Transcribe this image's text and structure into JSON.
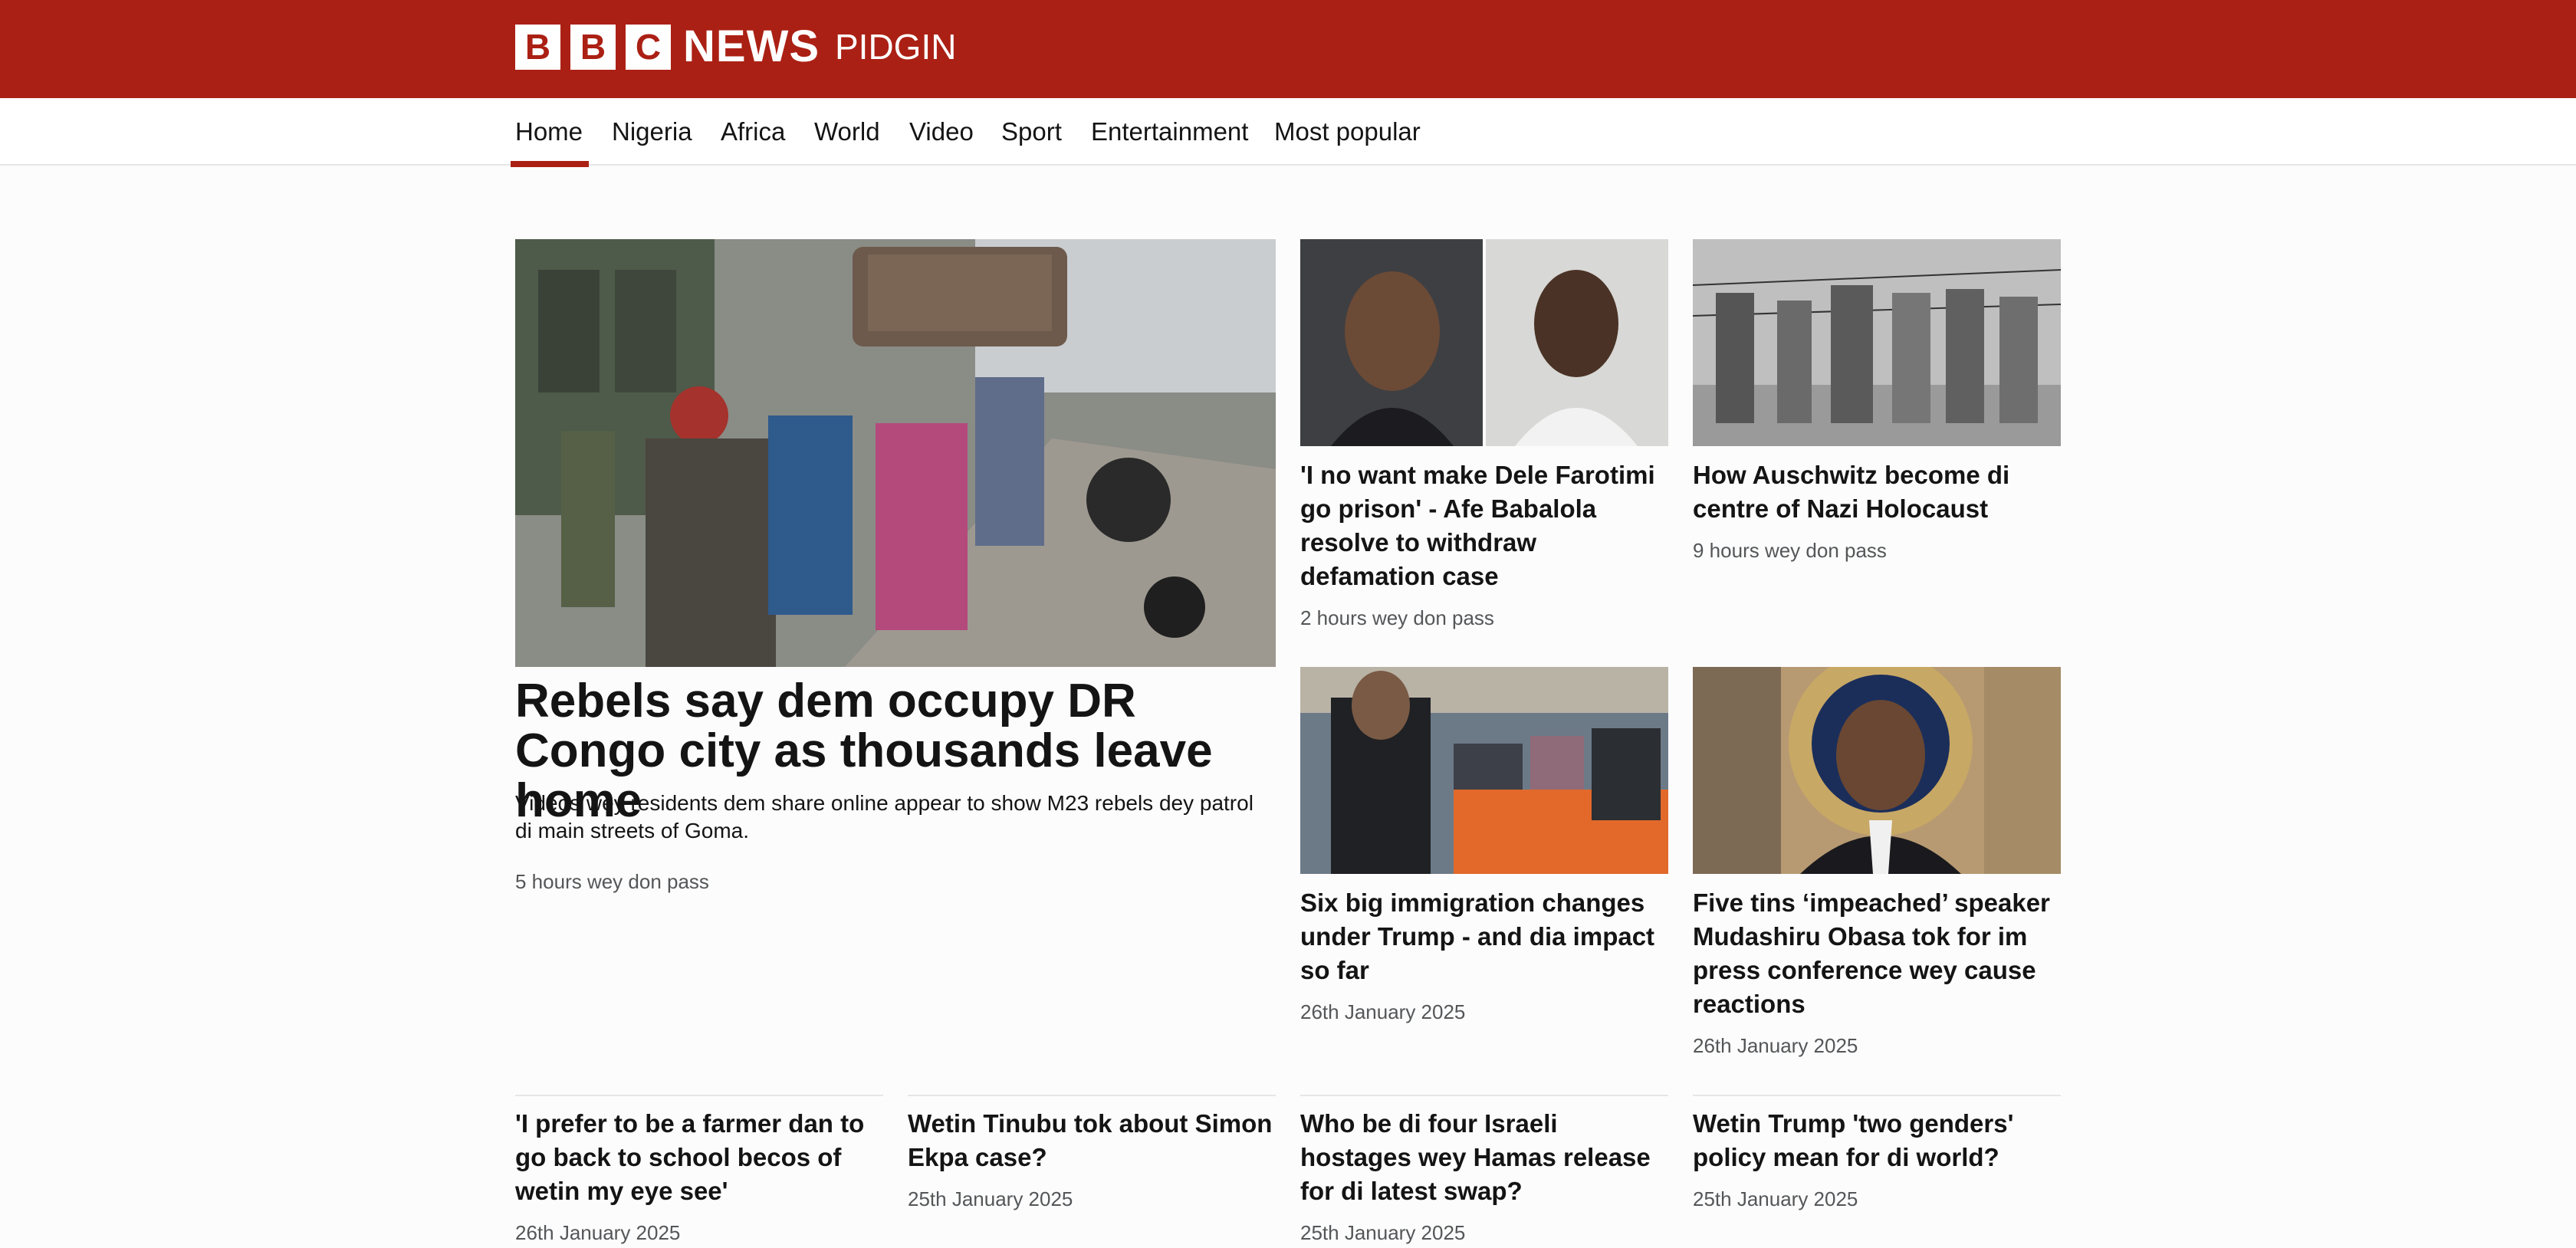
{
  "brand": {
    "letters": [
      "B",
      "B",
      "C"
    ],
    "news": "NEWS",
    "edition": "PIDGIN",
    "color": "#ab2014"
  },
  "nav": {
    "items": [
      "Home",
      "Nigeria",
      "Africa",
      "World",
      "Video",
      "Sport",
      "Entertainment",
      "Most popular"
    ],
    "active": "Home"
  },
  "lead": {
    "headline": "Rebels say dem occupy DR Congo city as thousands leave home",
    "summary": "Videos wey residents dem share online appear to show M23 rebels dey patrol di main streets of Goma.",
    "time": "5 hours wey don pass"
  },
  "stories": [
    {
      "headline": "'I no want make Dele Farotimi go prison' - Afe Babalola resolve to withdraw defamation case",
      "time": "2 hours wey don pass"
    },
    {
      "headline": "How Auschwitz become di centre of Nazi Holocaust",
      "time": "9 hours wey don pass"
    },
    {
      "headline": "Six big immigration changes under Trump - and dia impact so far",
      "time": "26th January 2025"
    },
    {
      "headline": "Five tins ‘impeached’ speaker Mudashiru Obasa tok for im press conference wey cause reactions",
      "time": "26th January 2025"
    }
  ],
  "bottom": [
    {
      "headline": "'I prefer to be a farmer dan to go back to school becos of wetin my eye see'",
      "time": "26th January 2025"
    },
    {
      "headline": "Wetin Tinubu tok about Simon Ekpa case?",
      "time": "25th January 2025"
    },
    {
      "headline": "Who be di four Israeli hostages wey Hamas release for di latest swap?",
      "time": "25th January 2025"
    },
    {
      "headline": "Wetin Trump 'two genders' policy mean for di world?",
      "time": "25th January 2025"
    }
  ]
}
